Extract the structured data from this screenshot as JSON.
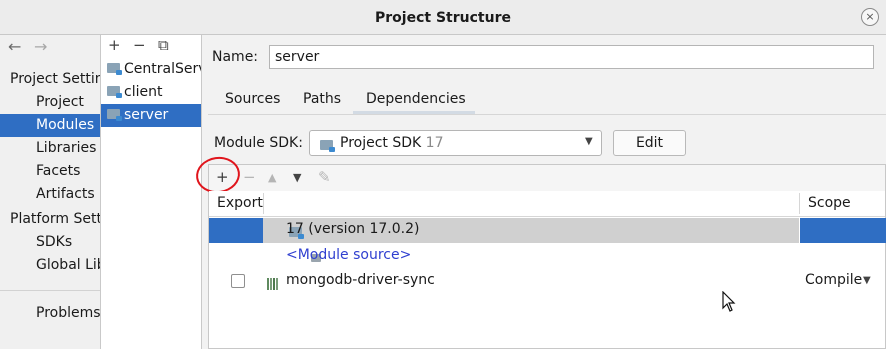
{
  "window": {
    "title": "Project Structure",
    "close_glyph": "×"
  },
  "nav": {
    "back_glyph": "←",
    "forward_glyph": "→",
    "sections": [
      {
        "label": "Project Settings",
        "items": [
          "Project",
          "Modules",
          "Libraries",
          "Facets",
          "Artifacts"
        ]
      },
      {
        "label": "Platform Settings",
        "items": [
          "SDKs",
          "Global Libraries"
        ]
      }
    ],
    "problems": "Problems",
    "selected": "Modules"
  },
  "module_list": {
    "toolbar": {
      "add": "+",
      "remove": "−",
      "copy": "⧉"
    },
    "items": [
      "CentralServer",
      "client",
      "server"
    ],
    "selected": "server"
  },
  "module": {
    "name_label": "Name:",
    "name_value": "server",
    "tabs": [
      "Sources",
      "Paths",
      "Dependencies"
    ],
    "active_tab": "Dependencies",
    "sdk_label": "Module SDK:",
    "sdk_value": "Project SDK",
    "sdk_version": "17",
    "edit_label": "Edit"
  },
  "dependencies": {
    "toolbar": {
      "add": "+",
      "remove": "−",
      "up": "▲",
      "down": "▼",
      "edit": "✎"
    },
    "columns": {
      "export": "Export",
      "scope": "Scope"
    },
    "rows": [
      {
        "name": "17 (version 17.0.2)",
        "scope": "",
        "selected": true
      },
      {
        "name": "<Module source>",
        "scope": ""
      },
      {
        "name": "mongodb-driver-sync",
        "scope": "Compile"
      }
    ]
  },
  "colors": {
    "selection": "#2f6ec3",
    "annotation": "#e0151c",
    "link": "#2f3fd0"
  }
}
